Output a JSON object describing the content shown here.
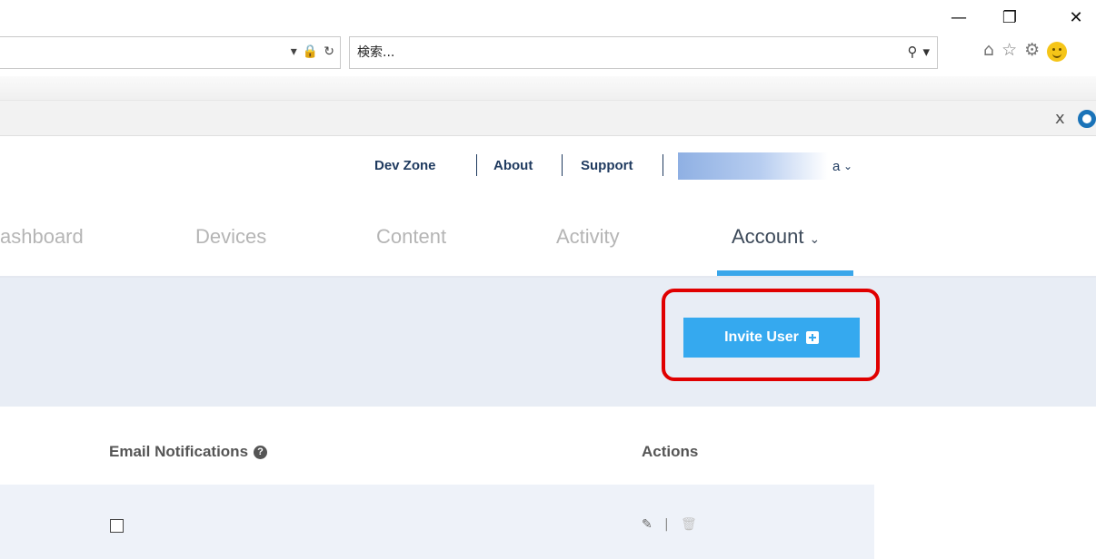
{
  "window": {
    "minimize_glyph": "—",
    "restore_glyph": "❐",
    "close_glyph": "✕"
  },
  "browser": {
    "address_icons": {
      "dropdown": "▾",
      "lock": "🔒",
      "refresh": "↻"
    },
    "search": {
      "placeholder": "検索...",
      "search_glyph": "⚲",
      "dropdown": "▾"
    },
    "tool_icons": [
      "home-icon",
      "star-icon",
      "gear-icon",
      "smiley-icon"
    ],
    "notification": {
      "close_label": "x"
    }
  },
  "header": {
    "links": [
      "Dev Zone",
      "About",
      "Support"
    ],
    "user": {
      "name_fragment": "a",
      "chevron": "⌄"
    }
  },
  "nav": {
    "items": [
      {
        "label": "ashboard",
        "active": false
      },
      {
        "label": "Devices",
        "active": false
      },
      {
        "label": "Content",
        "active": false
      },
      {
        "label": "Activity",
        "active": false
      },
      {
        "label": "Account",
        "active": true
      }
    ],
    "account_chevron": "⌄"
  },
  "actions": {
    "invite_label": "Invite User"
  },
  "table": {
    "columns": [
      "Email Notifications",
      "Actions"
    ],
    "help_glyph": "?",
    "rows": [
      {
        "email_notifications": false,
        "edit_glyph": "✎",
        "separator": "|",
        "delete_glyph": "🗑"
      }
    ]
  },
  "colors": {
    "accent": "#39a6ea",
    "button": "#35a9ef",
    "highlight": "#e00000",
    "nav_active": "#3d4a5a",
    "nav_inactive": "#b5b5b5",
    "band": "#e8edf5"
  }
}
